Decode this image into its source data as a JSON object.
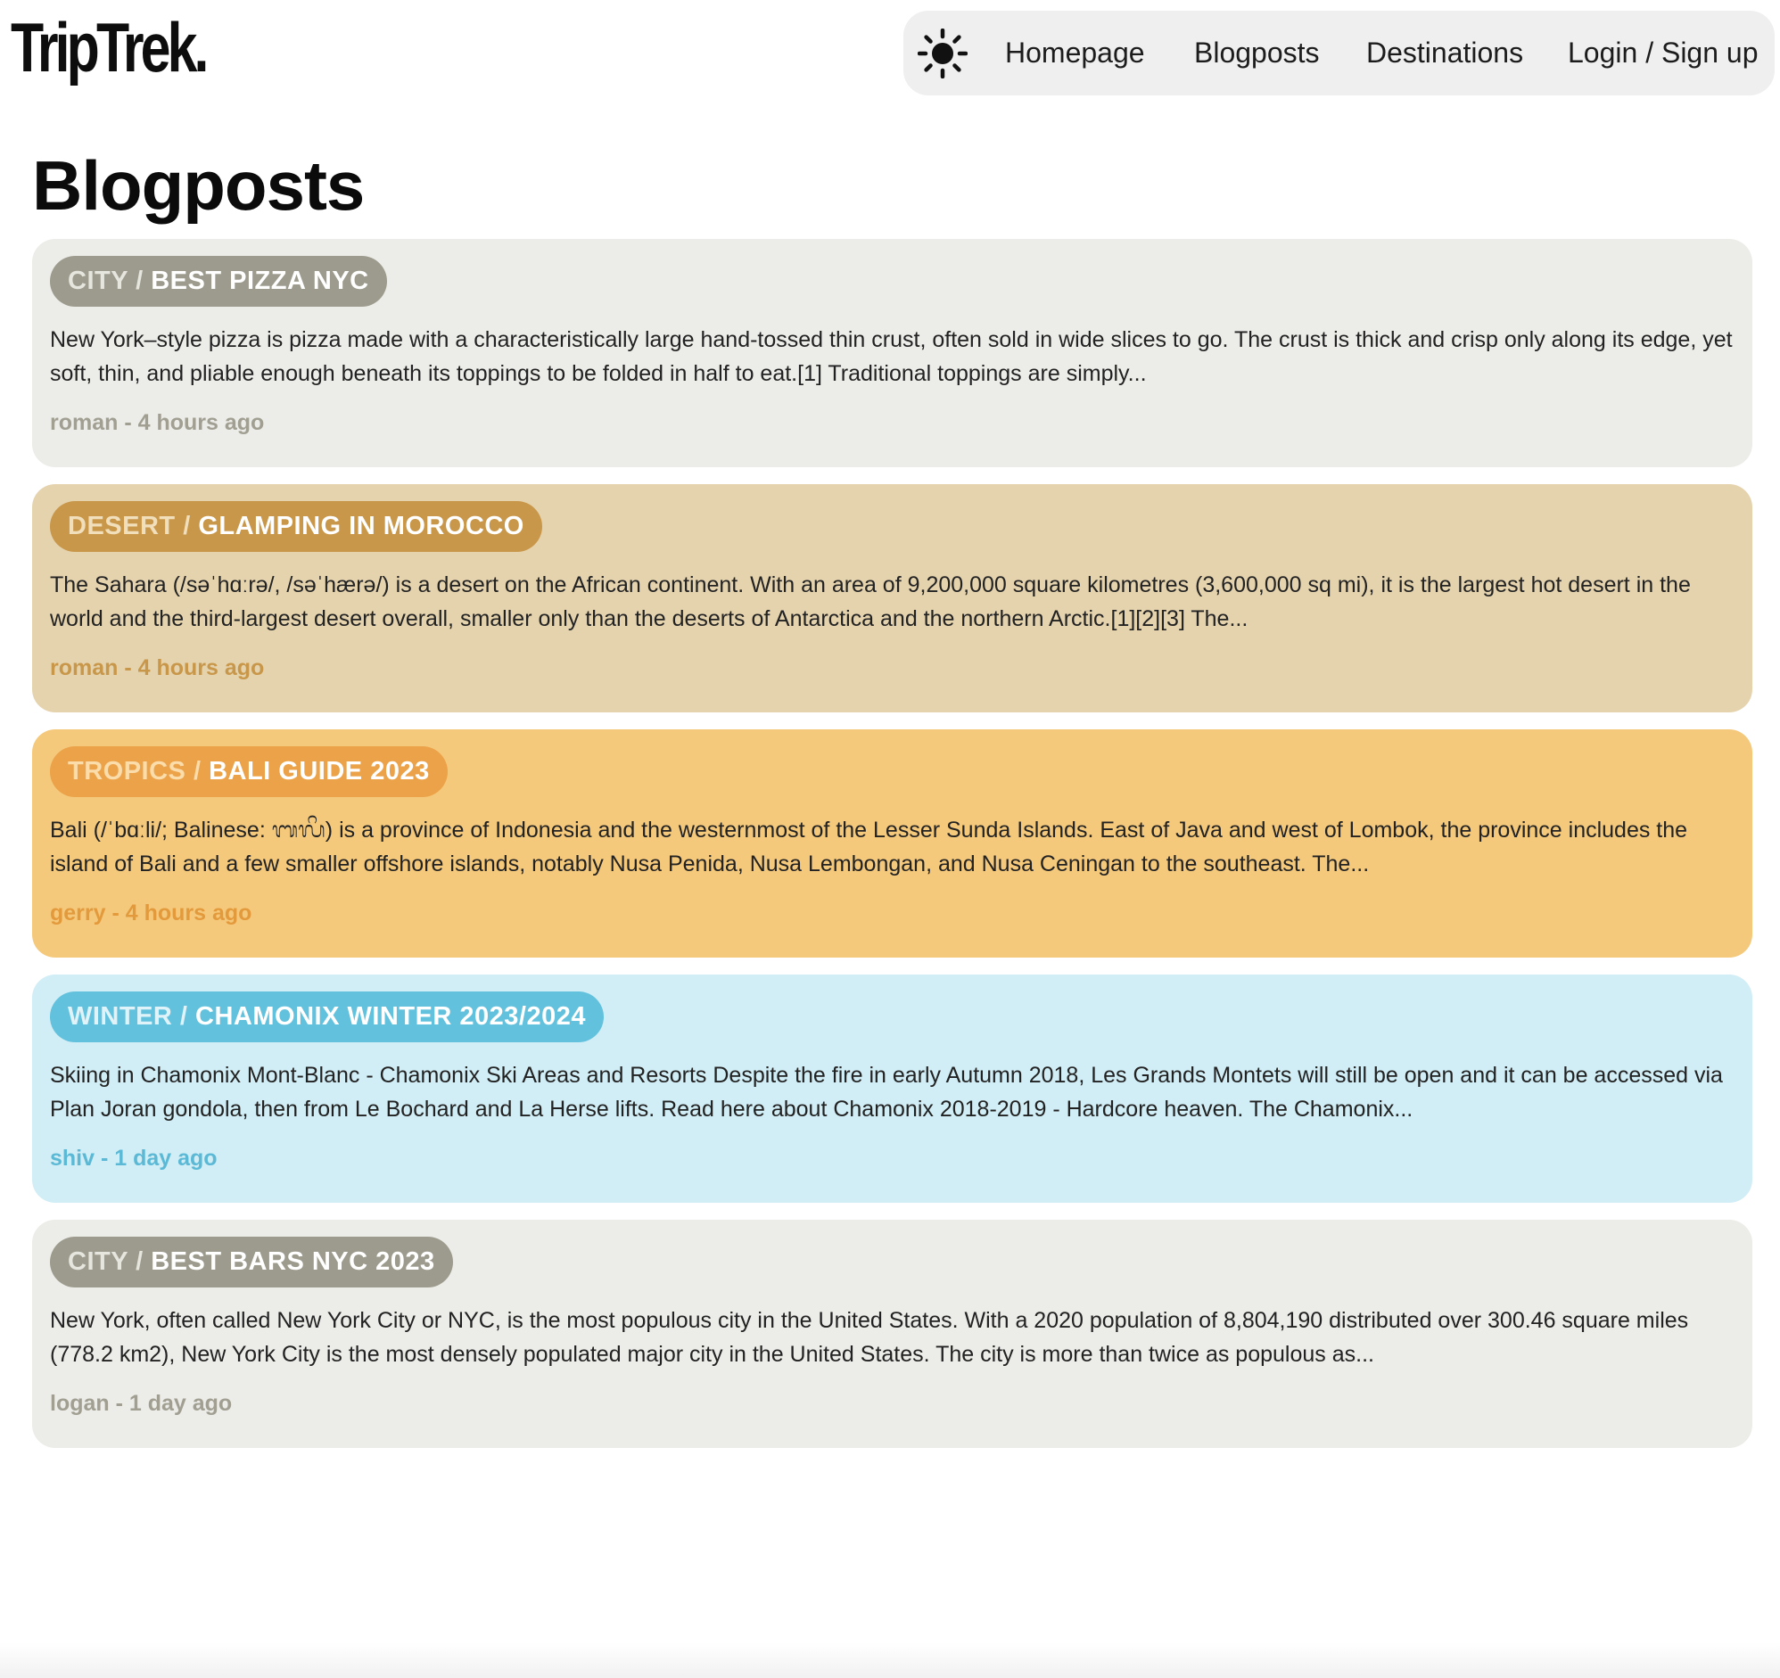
{
  "header": {
    "logo": "TripTrek.",
    "theme_toggle_icon": "sun-icon",
    "nav": {
      "homepage": "Homepage",
      "blogposts": "Blogposts",
      "destinations": "Destinations",
      "login": "Login / Sign up"
    }
  },
  "main": {
    "title": "Blogposts",
    "posts": [
      {
        "category": "CITY",
        "separator": " / ",
        "title": "BEST PIZZA NYC",
        "excerpt": "New York–style pizza is pizza made with a characteristically large hand-tossed thin crust, often sold in wide slices to go. The crust is thick and crisp only along its edge, yet soft, thin, and pliable enough beneath its toppings to be folded in half to eat.[1] Traditional toppings are simply...",
        "meta": "roman - 4 hours ago"
      },
      {
        "category": "DESERT",
        "separator": " / ",
        "title": "GLAMPING IN MOROCCO",
        "excerpt": "The Sahara (/səˈhɑːrə/, /səˈhærə/) is a desert on the African continent. With an area of 9,200,000 square kilometres (3,600,000 sq mi), it is the largest hot desert in the world and the third-largest desert overall, smaller only than the deserts of Antarctica and the northern Arctic.[1][2][3] The...",
        "meta": "roman - 4 hours ago"
      },
      {
        "category": "TROPICS",
        "separator": " / ",
        "title": "BALI GUIDE 2023",
        "excerpt": "Bali (/ˈbɑːli/; Balinese: ᬩᬮᬶ) is a province of Indonesia and the westernmost of the Lesser Sunda Islands. East of Java and west of Lombok, the province includes the island of Bali and a few smaller offshore islands, notably Nusa Penida, Nusa Lembongan, and Nusa Ceningan to the southeast. The...",
        "meta": "gerry - 4 hours ago"
      },
      {
        "category": "WINTER",
        "separator": " / ",
        "title": "CHAMONIX WINTER 2023/2024",
        "excerpt": "Skiing in Chamonix Mont-Blanc - Chamonix Ski Areas and Resorts Despite the fire in early Autumn 2018, Les Grands Montets will still be open and it can be accessed via Plan Joran gondola, then from Le Bochard and La Herse lifts. Read here about Chamonix 2018-2019 - Hardcore heaven. The Chamonix...",
        "meta": "shiv - 1 day ago"
      },
      {
        "category": "CITY",
        "separator": " / ",
        "title": "BEST BARS NYC 2023",
        "excerpt": "New York, often called New York City or NYC, is the most populous city in the United States. With a 2020 population of 8,804,190 distributed over 300.46 square miles (778.2 km2), New York City is the most densely populated major city in the United States. The city is more than twice as populous as...",
        "meta": "logan - 1 day ago"
      }
    ]
  },
  "colors": {
    "city_card": "#ecece8",
    "city_accent": "#9d9b8d",
    "desert_card": "#e5d3ae",
    "desert_accent": "#c8974a",
    "tropics_card": "#f5c97c",
    "tropics_accent": "#eba248",
    "winter_card": "#d1edf5",
    "winter_accent": "#62c1dd",
    "nav_background": "#efefef"
  }
}
